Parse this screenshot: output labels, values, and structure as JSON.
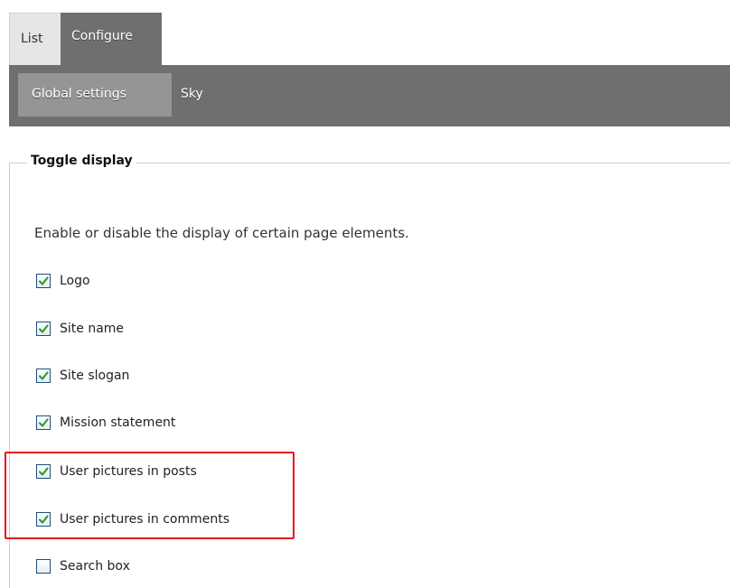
{
  "primary_tabs": {
    "list_label": "List",
    "configure_label": "Configure"
  },
  "secondary_tabs": {
    "global_label": "Global settings",
    "sky_label": "Sky"
  },
  "fieldset": {
    "legend": "Toggle display",
    "description": "Enable or disable the display of certain page elements.",
    "options": [
      {
        "label": "Logo",
        "checked": true
      },
      {
        "label": "Site name",
        "checked": true
      },
      {
        "label": "Site slogan",
        "checked": true
      },
      {
        "label": "Mission statement",
        "checked": true
      },
      {
        "label": "User pictures in posts",
        "checked": true
      },
      {
        "label": "User pictures in comments",
        "checked": true
      },
      {
        "label": "Search box",
        "checked": false
      }
    ]
  },
  "colors": {
    "tab_bar": "#6f6f6f",
    "active_subtab": "#959595",
    "highlight": "#e8141b",
    "checkmark": "#2e9b2e"
  }
}
